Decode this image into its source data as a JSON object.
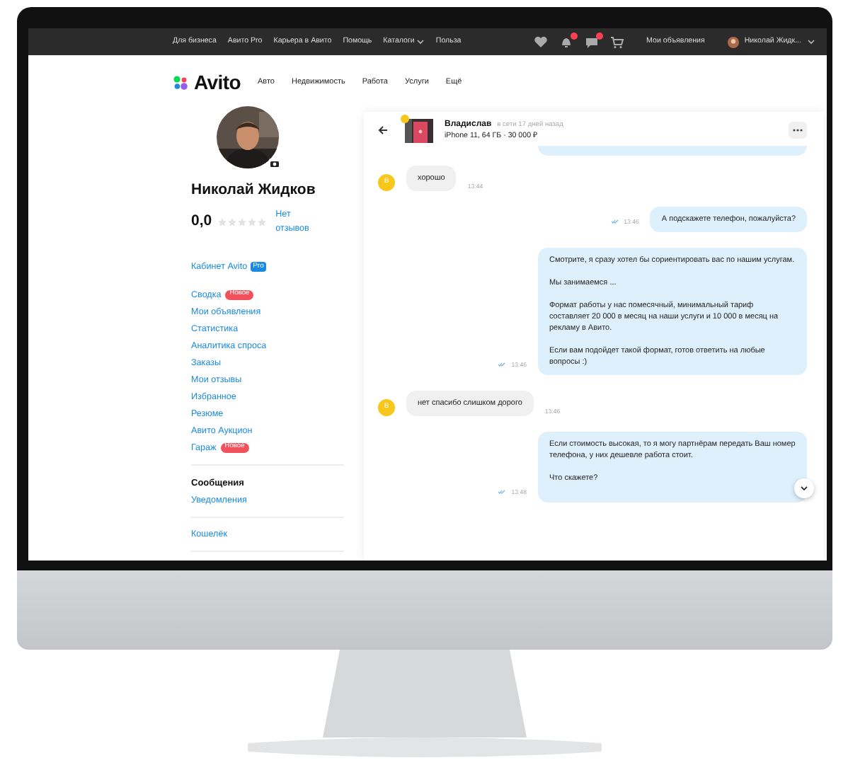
{
  "topbar": {
    "links": [
      {
        "label": "Для бизнеса",
        "dropdown": false
      },
      {
        "label": "Авито Pro",
        "dropdown": false
      },
      {
        "label": "Карьера в Авито",
        "dropdown": false
      },
      {
        "label": "Помощь",
        "dropdown": false
      },
      {
        "label": "Каталоги",
        "dropdown": true
      },
      {
        "label": "Польза",
        "dropdown": false
      }
    ],
    "icons": [
      {
        "kind": "heart",
        "badge": false
      },
      {
        "kind": "bell",
        "badge": true
      },
      {
        "kind": "chat",
        "badge": true
      },
      {
        "kind": "cart",
        "badge": false
      }
    ],
    "my_ads": "Мои объявления",
    "user": "Николай Жидк..."
  },
  "header": {
    "logo": "Avito",
    "nav": [
      "Авто",
      "Недвижимость",
      "Работа",
      "Услуги",
      "Ещё"
    ]
  },
  "profile": {
    "name": "Николай Жидков",
    "rating": "0,0",
    "stars": 0,
    "reviews": "Нет отзывов",
    "cabinet": "Кабинет Avito",
    "cabinet_badge": "Pro"
  },
  "menu": [
    {
      "kind": "link",
      "label": "Сводка",
      "badge": "Новое"
    },
    {
      "kind": "link",
      "label": "Мои объявления"
    },
    {
      "kind": "link",
      "label": "Статистика"
    },
    {
      "kind": "link",
      "label": "Аналитика спроса"
    },
    {
      "kind": "link",
      "label": "Заказы"
    },
    {
      "kind": "link",
      "label": "Мои отзывы"
    },
    {
      "kind": "link",
      "label": "Избранное"
    },
    {
      "kind": "link",
      "label": "Резюме"
    },
    {
      "kind": "link",
      "label": "Авито Аукцион"
    },
    {
      "kind": "link",
      "label": "Гараж",
      "badge": "Новое"
    },
    {
      "kind": "divider"
    },
    {
      "kind": "heading",
      "label": "Сообщения"
    },
    {
      "kind": "link",
      "label": "Уведомления"
    },
    {
      "kind": "divider"
    },
    {
      "kind": "link",
      "label": "Кошелёк"
    },
    {
      "kind": "divider"
    }
  ],
  "chat": {
    "name": "Владислав",
    "presence": "в сети 17 дней назад",
    "item": "iPhone 11, 64 ГБ · 30 000 ₽",
    "messages": [
      {
        "kind": "fragment"
      },
      {
        "kind": "incoming",
        "avatar_letter": "В",
        "paragraphs": [
          "хорошо"
        ],
        "time": "13:44"
      },
      {
        "kind": "outgoing",
        "paragraphs": [
          "А подскажете телефон, пожалуйста?"
        ],
        "time": "13:46",
        "read": true
      },
      {
        "kind": "outgoing",
        "paragraphs": [
          "Смотрите, я сразу хотел бы сориентировать вас по нашим услугам.",
          "Мы занимаемся ...",
          "Формат работы у нас помесячный, минимальный тариф составляет 20 000 в месяц на наши услуги и 10 000 в месяц на рекламу в Авито.",
          "Если вам подойдет такой формат, готов ответить на любые вопросы :)"
        ],
        "time": "13:46",
        "read": true
      },
      {
        "kind": "incoming",
        "avatar_letter": "В",
        "paragraphs": [
          "нет спасибо слишком дорого"
        ],
        "time": "13:46"
      },
      {
        "kind": "outgoing",
        "paragraphs": [
          "Если стоимость высокая, то я могу партнёрам передать Ваш номер телефона, у них дешевле работа стоит.",
          "Что скажете?"
        ],
        "time": "13:48",
        "read": true
      }
    ]
  }
}
